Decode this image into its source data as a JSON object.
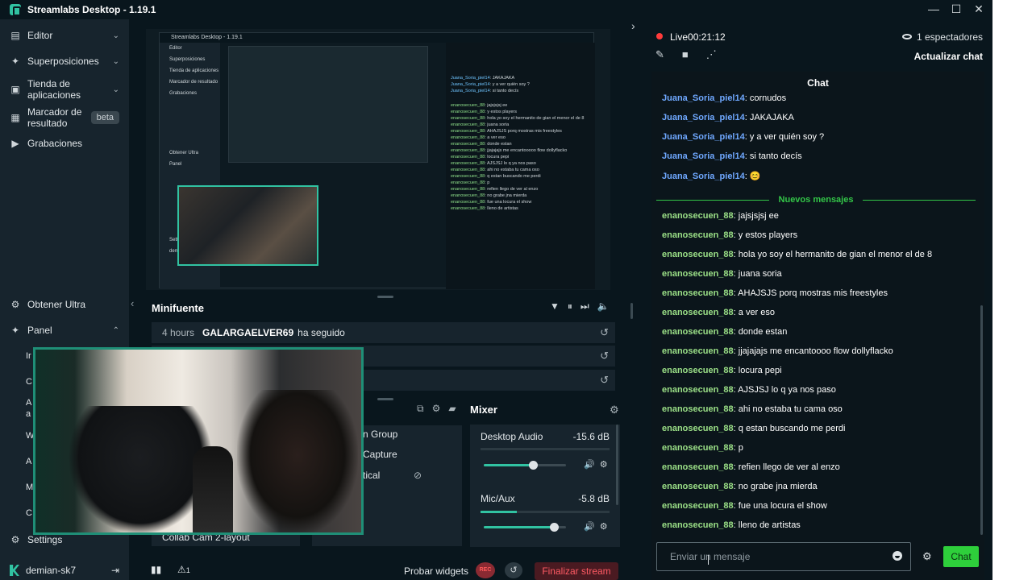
{
  "window": {
    "title": "Streamlabs Desktop - 1.19.1"
  },
  "nav": {
    "items": [
      {
        "label": "Editor"
      },
      {
        "label": "Superposiciones"
      },
      {
        "label": "Tienda de\naplicaciones"
      },
      {
        "label": "Marcador de\nresultado",
        "badge": "beta"
      },
      {
        "label": "Grabaciones"
      }
    ],
    "ultra": "Obtener Ultra",
    "panel": "Panel",
    "truncated": [
      "Ir",
      "C",
      "A",
      "a",
      "W",
      "A",
      "M",
      "C"
    ],
    "settings": "Settings",
    "user": "demian-sk7"
  },
  "preview": {
    "mini_title": "Streamlabs Desktop - 1.19.1",
    "mini_nav": [
      "Editor",
      "Superposiciones",
      "Tienda de aplicaciones",
      "Marcador de resultado",
      "Grabaciones",
      "Obtener Ultra",
      "Panel",
      "Settings",
      "demian-sk7"
    ],
    "mini_chat_lines": [
      {
        "u": "Juana_Soria_piel14",
        "m": "JAKAJAKA"
      },
      {
        "u": "Juana_Soria_piel14",
        "m": "y a ver quién soy ?"
      },
      {
        "u": "Juana_Soria_piel14",
        "m": "si tanto decís"
      },
      {
        "u": "enanosecuen_88",
        "m": "jajsjsjsj ee"
      },
      {
        "u": "enanosecuen_88",
        "m": "y estos players"
      },
      {
        "u": "enanosecuen_88",
        "m": "hola yo soy el hermanito de gian el menor el de 8"
      },
      {
        "u": "enanosecuen_88",
        "m": "juana soria"
      },
      {
        "u": "enanosecuen_88",
        "m": "AHAJSJS porq mostras mis freestyles"
      },
      {
        "u": "enanosecuen_88",
        "m": "a ver eso"
      },
      {
        "u": "enanosecuen_88",
        "m": "donde estan"
      },
      {
        "u": "enanosecuen_88",
        "m": "jjajajajs me encantooooo flow dollyflacko"
      },
      {
        "u": "enanosecuen_88",
        "m": "locura pepi"
      },
      {
        "u": "enanosecuen_88",
        "m": "AJSJSJ lo q ya nos paso"
      },
      {
        "u": "enanosecuen_88",
        "m": "ahi no estaba tu cama oso"
      },
      {
        "u": "enanosecuen_88",
        "m": "q estan buscando me perdi"
      },
      {
        "u": "enanosecuen_88",
        "m": "p"
      },
      {
        "u": "enanosecuen_88",
        "m": "refien llego de ver al enzo"
      },
      {
        "u": "enanosecuen_88",
        "m": "no grabe jna mierda"
      },
      {
        "u": "enanosecuen_88",
        "m": "fue una locura el show"
      },
      {
        "u": "enanosecuen_88",
        "m": "lleno de artistas"
      }
    ]
  },
  "feed": {
    "title": "Minifuente",
    "rows": [
      {
        "time": "4 hours",
        "user": "GALARGAELVER69",
        "action": "ha seguido"
      },
      {
        "time": "",
        "user": "",
        "action": ""
      },
      {
        "time": "",
        "user": "",
        "action": ""
      }
    ]
  },
  "sources": {
    "items": [
      "n Group",
      "Capture",
      "tical"
    ],
    "collab": "Collab Cam 2-layout"
  },
  "mixer": {
    "title": "Mixer",
    "channels": [
      {
        "name": "Desktop Audio",
        "db": "-15.6 dB",
        "volume": 0.6,
        "level": 0.0
      },
      {
        "name": "Mic/Aux",
        "db": "-5.8 dB",
        "volume": 0.85,
        "level": 0.28
      }
    ]
  },
  "footer": {
    "test_widgets": "Probar widgets",
    "rec": "REC",
    "end_stream": "Finalizar stream",
    "alert_count": "1"
  },
  "chat": {
    "live_label": "Live",
    "live_time": "00:21:12",
    "viewers": "1 espectadores",
    "refresh": "Actualizar chat",
    "header": "Chat",
    "separator": "Nuevos mensajes",
    "placeholder": "Enviar un mensaje",
    "send": "Chat",
    "colors": {
      "juana": "#6fa8ff",
      "enano": "#9be087",
      "separator": "#33c648",
      "send_bg": "#2ecf3b"
    },
    "before": [
      {
        "user": "Juana_Soria_piel14",
        "text": ": cornudos"
      },
      {
        "user": "Juana_Soria_piel14",
        "text": ": JAKAJAKA"
      },
      {
        "user": "Juana_Soria_piel14",
        "text": ": y a ver quién soy ?"
      },
      {
        "user": "Juana_Soria_piel14",
        "text": ": si tanto decís"
      },
      {
        "user": "Juana_Soria_piel14",
        "text": ": 😊"
      }
    ],
    "after": [
      {
        "user": "enanosecuen_88",
        "text": ": jajsjsjsj ee"
      },
      {
        "user": "enanosecuen_88",
        "text": ": y estos players"
      },
      {
        "user": "enanosecuen_88",
        "text": ": hola yo soy el hermanito de gian el menor el de 8"
      },
      {
        "user": "enanosecuen_88",
        "text": ": juana soria"
      },
      {
        "user": "enanosecuen_88",
        "text": ": AHAJSJS porq mostras mis freestyles"
      },
      {
        "user": "enanosecuen_88",
        "text": ": a ver eso"
      },
      {
        "user": "enanosecuen_88",
        "text": ": donde estan"
      },
      {
        "user": "enanosecuen_88",
        "text": ": jjajajajs me encantoooo flow dollyflacko"
      },
      {
        "user": "enanosecuen_88",
        "text": ": locura pepi"
      },
      {
        "user": "enanosecuen_88",
        "text": ": AJSJSJ lo q ya nos paso"
      },
      {
        "user": "enanosecuen_88",
        "text": ": ahi no estaba tu cama oso"
      },
      {
        "user": "enanosecuen_88",
        "text": ": q estan buscando me perdi"
      },
      {
        "user": "enanosecuen_88",
        "text": ": p"
      },
      {
        "user": "enanosecuen_88",
        "text": ": refien llego de ver al enzo"
      },
      {
        "user": "enanosecuen_88",
        "text": ": no grabe jna mierda"
      },
      {
        "user": "enanosecuen_88",
        "text": ": fue una locura el show"
      },
      {
        "user": "enanosecuen_88",
        "text": ": lleno de artistas"
      }
    ]
  }
}
